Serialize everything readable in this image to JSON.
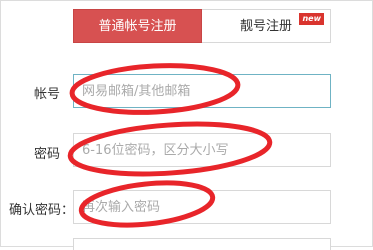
{
  "tabs": {
    "normal_label": "普通帐号注册",
    "vip_label": "靓号注册",
    "new_badge": "new"
  },
  "form": {
    "account_label": "帐号",
    "account_placeholder": "网易邮箱/其他邮箱",
    "password_label": "密码",
    "password_placeholder": "6-16位密码，区分大小写",
    "confirm_label": "确认密码：",
    "confirm_placeholder": "再次输入密码"
  },
  "colors": {
    "accent": "#d75151",
    "annotation": "#e8252a",
    "focus_border": "#6fb3c4"
  }
}
